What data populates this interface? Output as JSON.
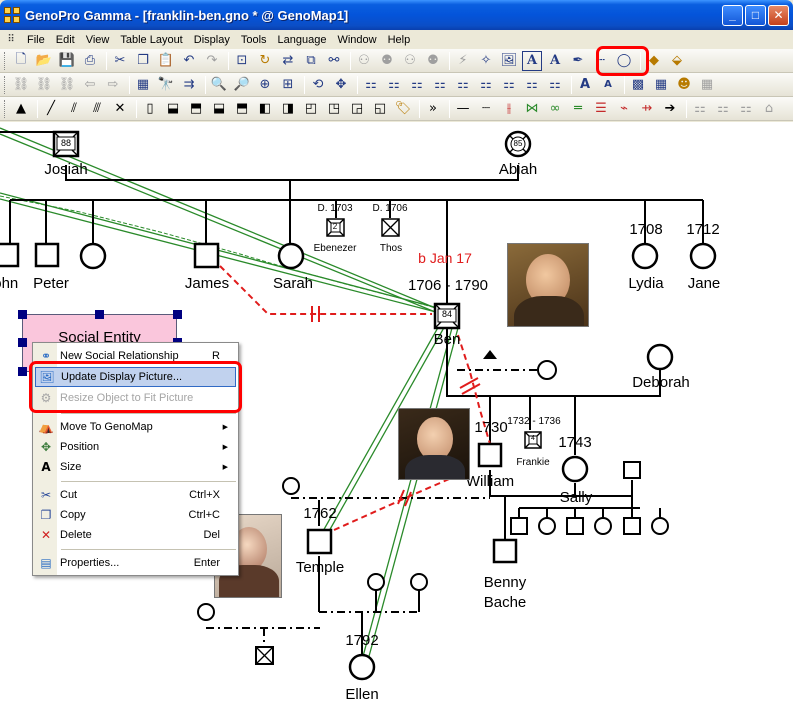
{
  "window": {
    "title": "GenoPro Gamma - [franklin-ben.gno * @ GenoMap1]",
    "controls": [
      "_",
      "□",
      "✕"
    ]
  },
  "menu": [
    "File",
    "Edit",
    "View",
    "Table Layout",
    "Display",
    "Tools",
    "Language",
    "Window",
    "Help"
  ],
  "toolbars": {
    "row1_icons": [
      "new-icon",
      "open-icon",
      "save-icon",
      "print-icon",
      "cut-icon",
      "copy-icon",
      "paste-icon",
      "undo-icon",
      "redo-icon",
      "new-genomap-icon",
      "refresh-icon",
      "arrange-icon",
      "tree-icon",
      "family-icon",
      "family-icon",
      "tree-icon",
      "link-icon",
      "magic-icon",
      "update-display-picture-icon",
      "text-frame-icon",
      "font-icon",
      "pen-icon",
      "dash-line-icon",
      "circle-icon",
      "fill-icon",
      "eraser-icon"
    ],
    "highlighted_group": [
      "update-display-picture-icon",
      "text-frame-icon"
    ]
  },
  "canvas": {
    "people": [
      {
        "name": "Josiah",
        "age_badge": "88"
      },
      {
        "name": "Abiah",
        "age_badge": "85"
      },
      {
        "name": "John"
      },
      {
        "name": "Peter"
      },
      {
        "name": "James"
      },
      {
        "name": "Sarah"
      },
      {
        "name": "Ebenezer",
        "dates": "D. 1703",
        "age_badge": "2"
      },
      {
        "name": "Thos",
        "dates": "D. 1706"
      },
      {
        "name": "Lydia",
        "dates": "1708"
      },
      {
        "name": "Jane",
        "dates": "1712"
      },
      {
        "name": "Ben",
        "dates": "1706 - 1790",
        "note": "b Jan 17",
        "age_badge": "84"
      },
      {
        "name": "Deborah"
      },
      {
        "name": "William",
        "dates": "1730"
      },
      {
        "name": "Frankie",
        "dates": "1732 - 1736",
        "age_badge": "4"
      },
      {
        "name": "Sally",
        "dates": "1743"
      },
      {
        "name": "Temple",
        "dates": "1762"
      },
      {
        "name": "Benny Bache"
      },
      {
        "name": "Ellen",
        "dates": "1792"
      }
    ],
    "social_entity": {
      "label": "Social Entity"
    }
  },
  "context_menu": {
    "items": [
      {
        "label": "New Social Relationship",
        "shortcut": "R",
        "icon": "new-relationship-icon"
      },
      {
        "label": "Update Display Picture...",
        "shortcut": "",
        "icon": "picture-icon",
        "highlighted": true
      },
      {
        "label": "Resize Object to Fit Picture",
        "shortcut": "",
        "icon": "resize-icon",
        "disabled": true
      },
      {
        "label": "Move To GenoMap",
        "shortcut": "",
        "icon": "genomap-icon",
        "submenu": true
      },
      {
        "label": "Position",
        "shortcut": "",
        "icon": "position-icon",
        "submenu": true
      },
      {
        "label": "Size",
        "shortcut": "",
        "icon": "size-icon",
        "submenu": true
      },
      {
        "label": "Cut",
        "shortcut": "Ctrl+X",
        "icon": "cut-icon"
      },
      {
        "label": "Copy",
        "shortcut": "Ctrl+C",
        "icon": "copy-icon"
      },
      {
        "label": "Delete",
        "shortcut": "Del",
        "icon": "delete-icon"
      },
      {
        "label": "Properties...",
        "shortcut": "Enter",
        "icon": "properties-icon"
      }
    ]
  },
  "colors": {
    "highlight_outline": "#ff0000",
    "social_entity_fill": "#fac6dc",
    "relationship_line": "#e01c1c",
    "twin_line": "#2a8a2a",
    "selection_handle": "#000080"
  }
}
